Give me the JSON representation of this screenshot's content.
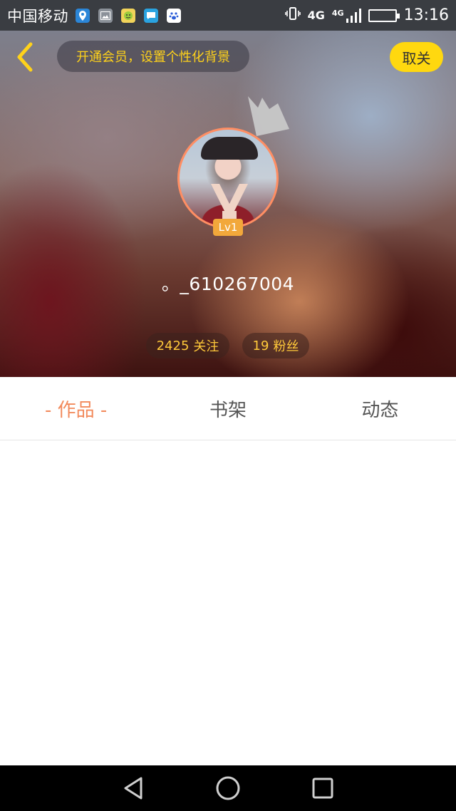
{
  "status_bar": {
    "carrier": "中国移动",
    "network_1": "4G",
    "network_2": "4G",
    "time": "13:16",
    "notification_icons": [
      "location-icon",
      "gallery-icon",
      "emoji-icon",
      "message-icon",
      "baidu-paw-icon"
    ]
  },
  "header": {
    "promo_text": "开通会员，设置个性化背景",
    "close_label": "取关",
    "level": "Lv1",
    "username": "。_610267004",
    "following_count": "2425",
    "following_label": "关注",
    "fans_count": "19",
    "fans_label": "粉丝"
  },
  "tabs": [
    {
      "label": "- 作品 -",
      "active": true
    },
    {
      "label": "书架",
      "active": false
    },
    {
      "label": "动态",
      "active": false
    }
  ],
  "colors": {
    "accent": "#f28a5c",
    "promo_text": "#ffd21a",
    "close_button": "#ffd80f",
    "stat_text": "#ffc93a",
    "level_badge": "#f2a83b"
  }
}
